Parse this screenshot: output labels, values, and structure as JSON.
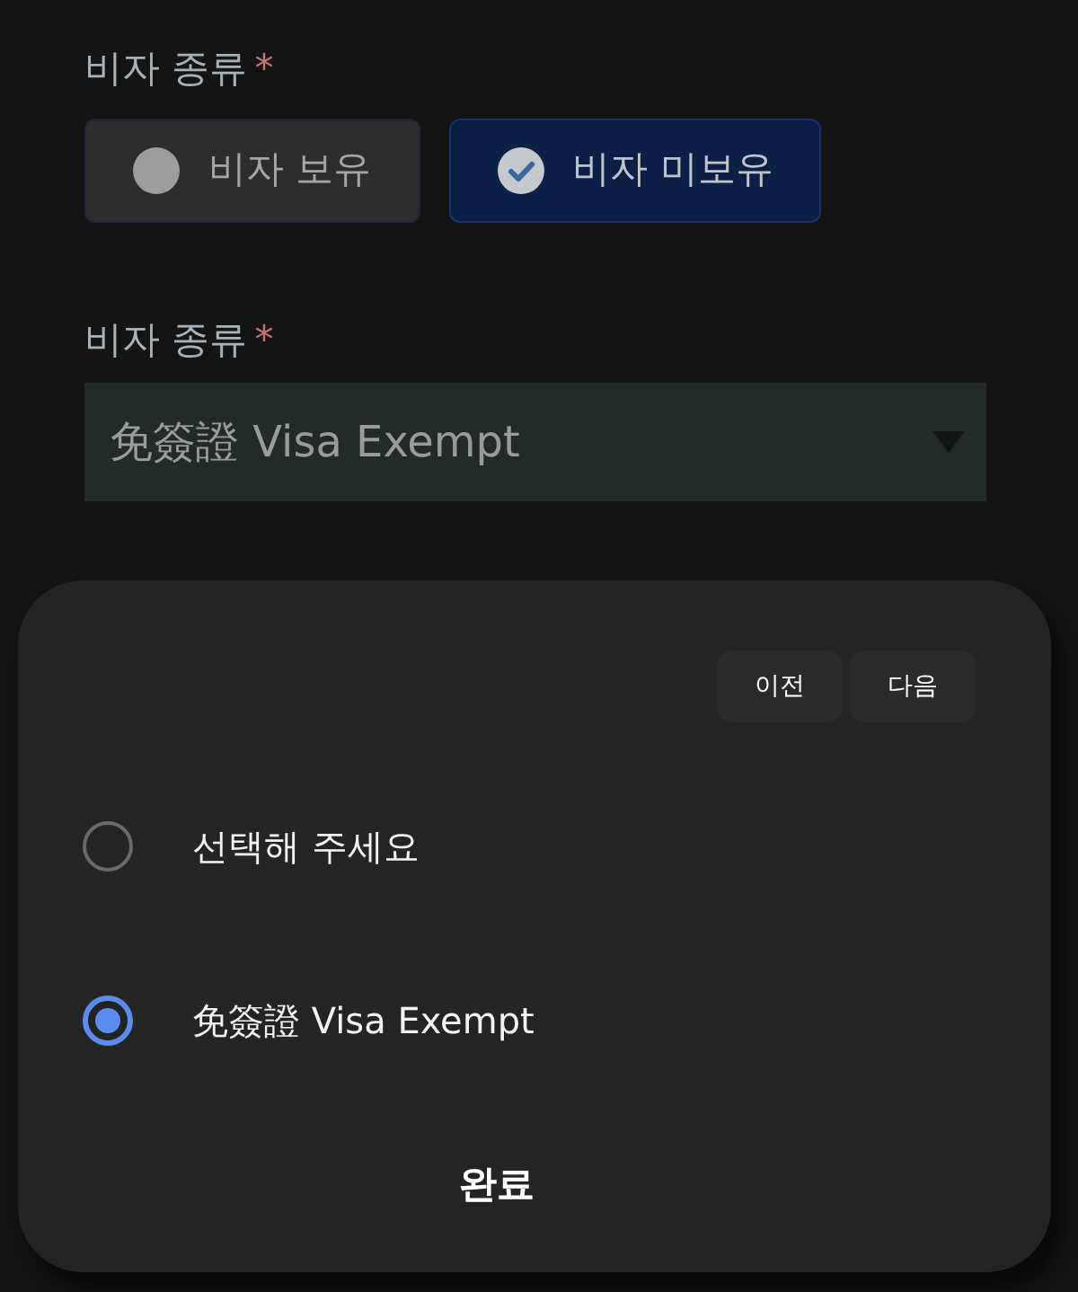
{
  "form": {
    "fields": [
      {
        "kind": "toggle",
        "label": "비자 종류",
        "required_mark": "*",
        "options": [
          {
            "label": "비자 보유",
            "selected": false
          },
          {
            "label": "비자 미보유",
            "selected": true
          }
        ]
      },
      {
        "kind": "select",
        "label": "비자 종류",
        "required_mark": "*",
        "value": "免簽證 Visa Exempt"
      }
    ]
  },
  "picker_sheet": {
    "nav_buttons": [
      {
        "label": "이전"
      },
      {
        "label": "다음"
      }
    ],
    "options": [
      {
        "label": "선택해 주세요",
        "selected": false
      },
      {
        "label": "免簽證 Visa Exempt",
        "selected": true
      }
    ],
    "done_button": "완료"
  }
}
